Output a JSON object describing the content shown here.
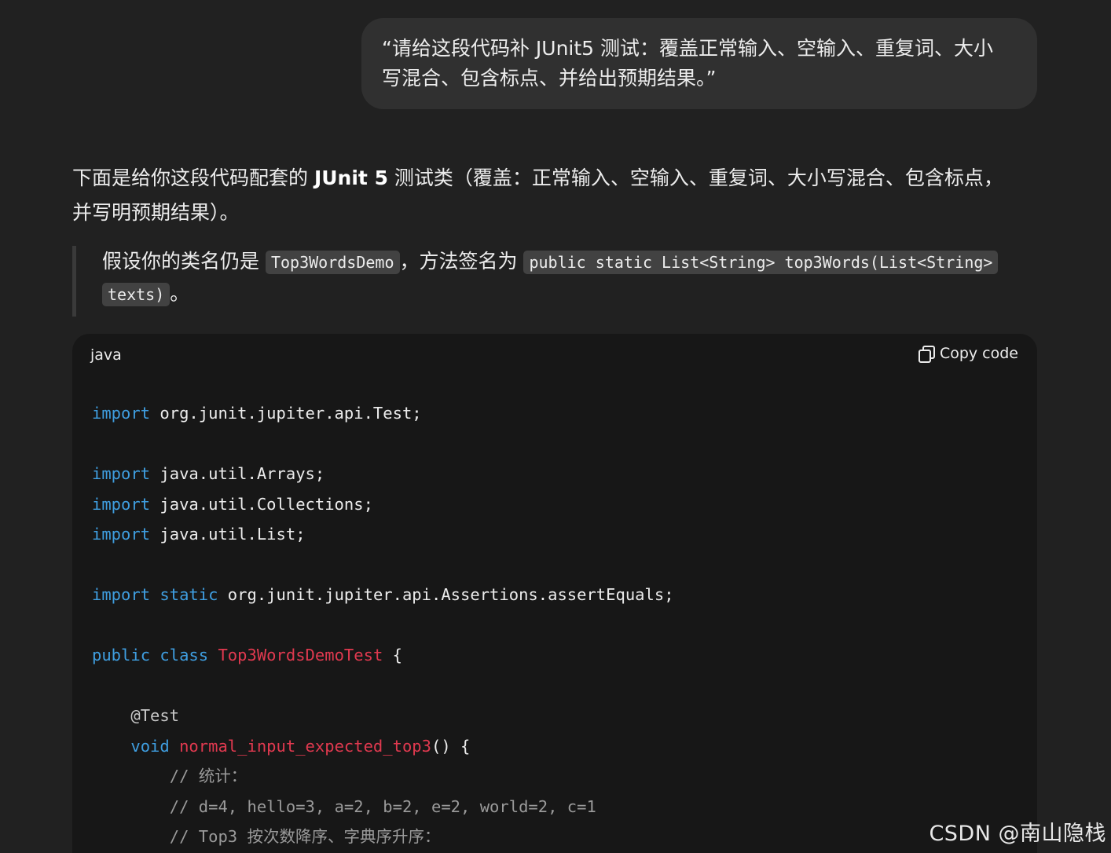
{
  "user_message": {
    "line1": "“请给这段代码补 JUnit5 测试：覆盖正常输入、空输入、重复词、大小",
    "line2": "写混合、包含标点、并给出预期结果。”"
  },
  "assistant": {
    "intro_part1": "下面是给你这段代码配套的 ",
    "intro_bold": "JUnit 5",
    "intro_part2": " 测试类（覆盖：正常输入、空输入、重复词、大小写混合、包含标点，",
    "intro_line2": "并写明预期结果）。",
    "quote": {
      "text1": "假设你的类名仍是 ",
      "code1": "Top3WordsDemo",
      "text2": "，方法签名为 ",
      "code2a": "public static List<String> top3Words(List<String>",
      "code2b": "texts)",
      "text3": "。"
    }
  },
  "codeblock": {
    "language": "java",
    "copy_label": "Copy code",
    "lines": {
      "l1_kw": "import",
      "l1_rest": " org.junit.jupiter.api.Test;",
      "l3_kw": "import",
      "l3_rest": " java.util.Arrays;",
      "l4_kw": "import",
      "l4_rest": " java.util.Collections;",
      "l5_kw": "import",
      "l5_rest": " java.util.List;",
      "l7_kw1": "import",
      "l7_kw2": "static",
      "l7_rest": " org.junit.jupiter.api.Assertions.assertEquals;",
      "l9_kw1": "public",
      "l9_kw2": "class",
      "l9_cls": "Top3WordsDemoTest",
      "l9_rest": " {",
      "l11_ann": "@Test",
      "l12_kw": "void",
      "l12_fn": "normal_input_expected_top3",
      "l12_rest": "() {",
      "l13_cmt": "// 统计：",
      "l14_cmt": "// d=4, hello=3, a=2, b=2, e=2, world=2, c=1",
      "l15_cmt": "// Top3 按次数降序、字典序升序："
    }
  },
  "watermark": "CSDN @南山隐栈",
  "colors": {
    "background": "#212121",
    "bubble": "#303030",
    "code_background": "#171717",
    "keyword": "#3f9ee0",
    "class_name": "#e0394f",
    "comment": "#9a9a9a"
  }
}
